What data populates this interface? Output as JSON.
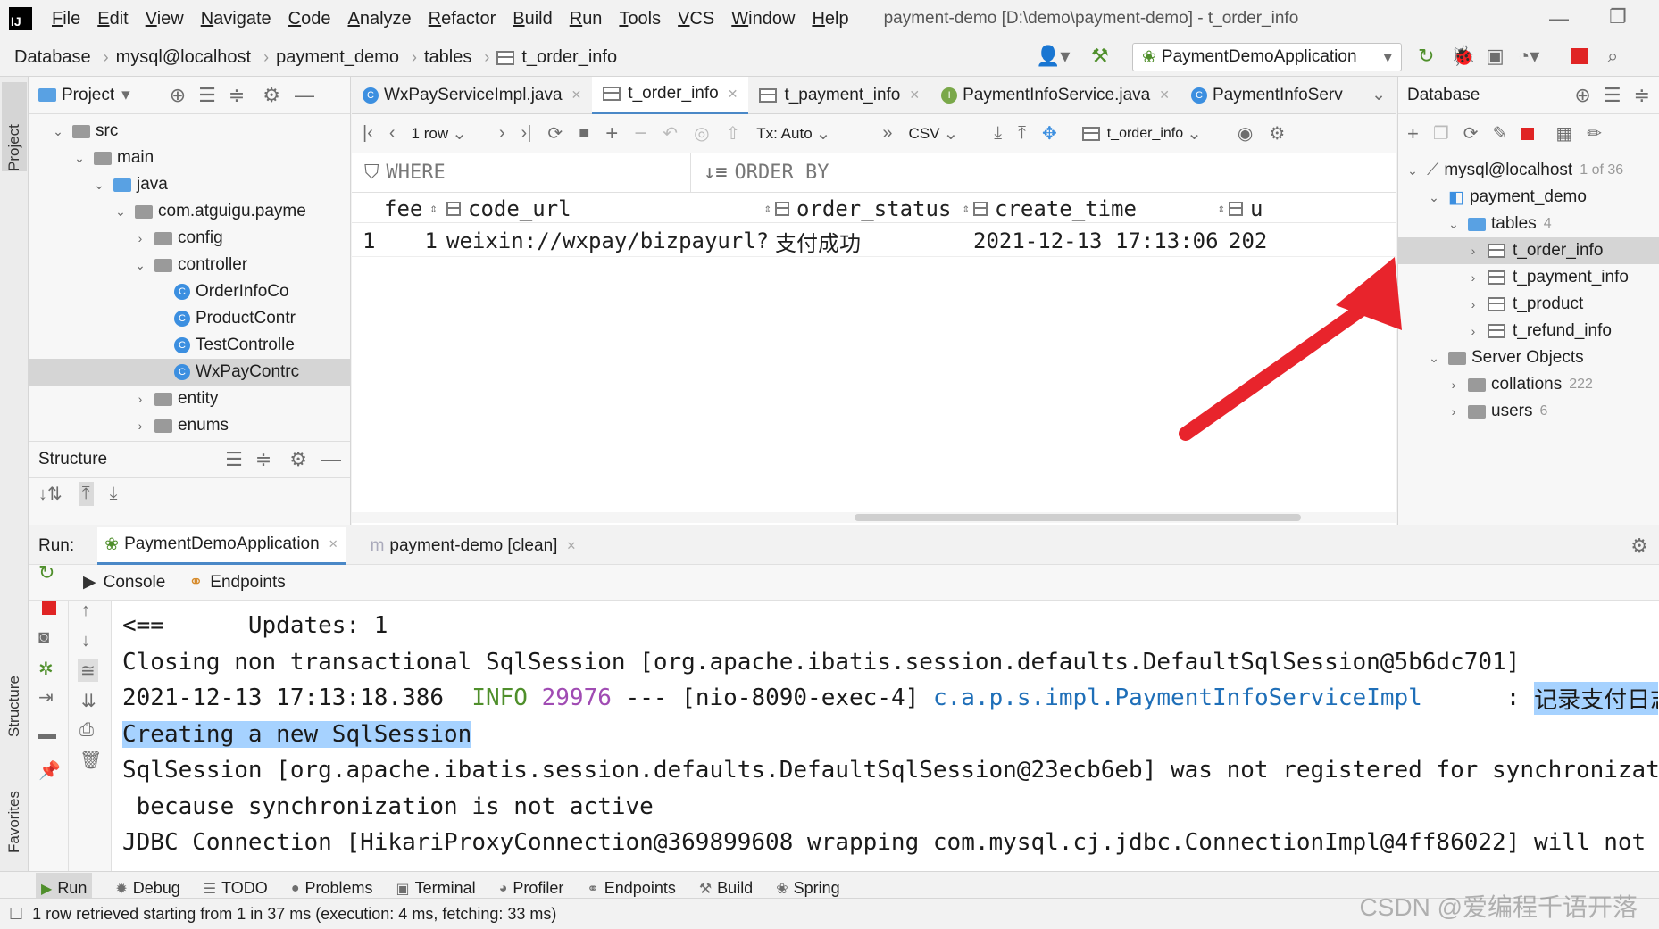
{
  "menubar": {
    "logo": "IJ",
    "items": [
      "File",
      "Edit",
      "View",
      "Navigate",
      "Code",
      "Analyze",
      "Refactor",
      "Build",
      "Run",
      "Tools",
      "VCS",
      "Window",
      "Help"
    ],
    "window_title": "payment-demo [D:\\demo\\payment-demo] - t_order_info"
  },
  "navbar": {
    "breadcrumbs": [
      "Database",
      "mysql@localhost",
      "payment_demo",
      "tables",
      "t_order_info"
    ],
    "run_config": "PaymentDemoApplication"
  },
  "left_stripe": {
    "project": "Project",
    "structure": "Structure",
    "favorites": "Favorites"
  },
  "project_panel": {
    "title": "Project",
    "tree": [
      {
        "label": "src"
      },
      {
        "label": "main"
      },
      {
        "label": "java"
      },
      {
        "label": "com.atguigu.payme"
      },
      {
        "label": "config"
      },
      {
        "label": "controller"
      },
      {
        "label": "OrderInfoCo"
      },
      {
        "label": "ProductContr"
      },
      {
        "label": "TestControlle"
      },
      {
        "label": "WxPayContrc"
      },
      {
        "label": "entity"
      },
      {
        "label": "enums"
      }
    ],
    "structure_title": "Structure"
  },
  "editor": {
    "tabs": [
      "WxPayServiceImpl.java",
      "t_order_info",
      "t_payment_info",
      "PaymentInfoService.java",
      "PaymentInfoServ"
    ],
    "toolbar": {
      "rows": "1 row",
      "tx": "Tx: Auto",
      "export": "CSV",
      "table": "t_order_info"
    },
    "where": "WHERE",
    "order_by": "ORDER BY",
    "columns": [
      "fee",
      "code_url",
      "order_status",
      "create_time",
      "u"
    ],
    "rows": [
      {
        "num": "1",
        "fee": "1",
        "code_url": "weixin://wxpay/bizpayurl?pr…",
        "order_status": "支付成功",
        "create_time": "2021-12-13 17:13:06",
        "extra": "202"
      }
    ]
  },
  "db_panel": {
    "title": "Database",
    "tree": {
      "host": "mysql@localhost",
      "host_count": "1 of 36",
      "schema": "payment_demo",
      "tables_label": "tables",
      "tables_count": "4",
      "tables": [
        "t_order_info",
        "t_payment_info",
        "t_product",
        "t_refund_info"
      ],
      "server_objects": "Server Objects",
      "collations": "collations",
      "collations_count": "222",
      "users": "users",
      "users_count": "6"
    }
  },
  "run_panel": {
    "label": "Run:",
    "tabs": [
      "PaymentDemoApplication",
      "payment-demo [clean]"
    ],
    "subtabs": [
      "Console",
      "Endpoints"
    ],
    "console": {
      "l1": "<==      Updates: 1",
      "l2": "Closing non transactional SqlSession [org.apache.ibatis.session.defaults.DefaultSqlSession@5b6dc701]",
      "l3_time": "2021-12-13 17:13:18.386",
      "l3_level": "INFO",
      "l3_pid": "29976",
      "l3_thread": "--- [nio-8090-exec-4]",
      "l3_logger": "c.a.p.s.impl.PaymentInfoServiceImpl",
      "l3_colon": ":",
      "l3_msg": "记录支付日志",
      "l4": "Creating a new SqlSession",
      "l5": "SqlSession [org.apache.ibatis.session.defaults.DefaultSqlSession@23ecb6eb] was not registered for synchronization",
      "l6": " because synchronization is not active",
      "l7": "JDBC Connection [HikariProxyConnection@369899608 wrapping com.mysql.cj.jdbc.ConnectionImpl@4ff86022] will not be"
    }
  },
  "bottom_bar": [
    "Run",
    "Debug",
    "TODO",
    "Problems",
    "Terminal",
    "Profiler",
    "Endpoints",
    "Build",
    "Spring"
  ],
  "status": {
    "message": "1 row retrieved starting from 1 in 37 ms (execution: 4 ms, fetching: 33 ms)",
    "watermark": "CSDN @爱编程千语开落"
  },
  "colors": {
    "accent": "#4a88c7",
    "selection": "#a6d2ff",
    "arrow": "#e8242c"
  }
}
